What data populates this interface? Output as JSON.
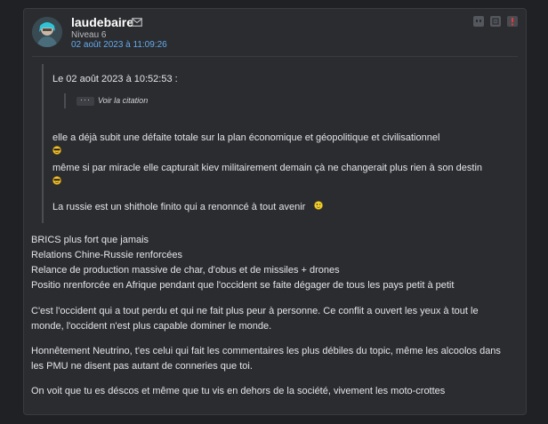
{
  "post": {
    "author": "laudebaire",
    "level": "Niveau 6",
    "date": "02 août 2023 à 11:09:26",
    "icons": {
      "mp": "envelope-icon",
      "quote": "quote-icon",
      "reply": "reply-icon",
      "alert": "alert-icon"
    },
    "quote": {
      "header": "Le 02 août 2023 à 10:52:53 :",
      "see_quote_label": "Voir la citation",
      "lines": [
        "elle a déjà subit une défaite totale sur la plan économique et géopolitique et civilisationnel",
        "même si par miracle elle capturait kiev militairement demain çà ne changerait plus rien à son destin",
        "La russie est un shithole finito qui a renonncé à tout avenir"
      ]
    },
    "body": {
      "paragraphs": [
        [
          "BRICS plus fort que jamais",
          "Relations Chine-Russie renforcées",
          "Relance de production massive de char, d'obus et de missiles + drones",
          "Positio nrenforcée en Afrique pendant que l'occident se faite dégager de tous les pays petit à petit"
        ],
        [
          "C'est l'occident qui a tout perdu et qui ne fait plus peur à personne. Ce conflit a ouvert les yeux à tout le",
          "monde, l'occident n'est plus capable dominer le monde."
        ],
        [
          "Honnêtement Neutrino, t'es celui qui fait les commentaires les plus débiles du topic, même les alcoolos dans",
          "les PMU ne disent pas autant de conneries que toi."
        ],
        [
          "On voit que tu es déscos et même que tu vis en dehors de la société, vivement les moto-crottes"
        ]
      ]
    },
    "colors": {
      "page_bg": "#202124",
      "card_bg": "#2b2c2f",
      "date_link": "#63abee",
      "alert": "#e03a3a"
    }
  }
}
